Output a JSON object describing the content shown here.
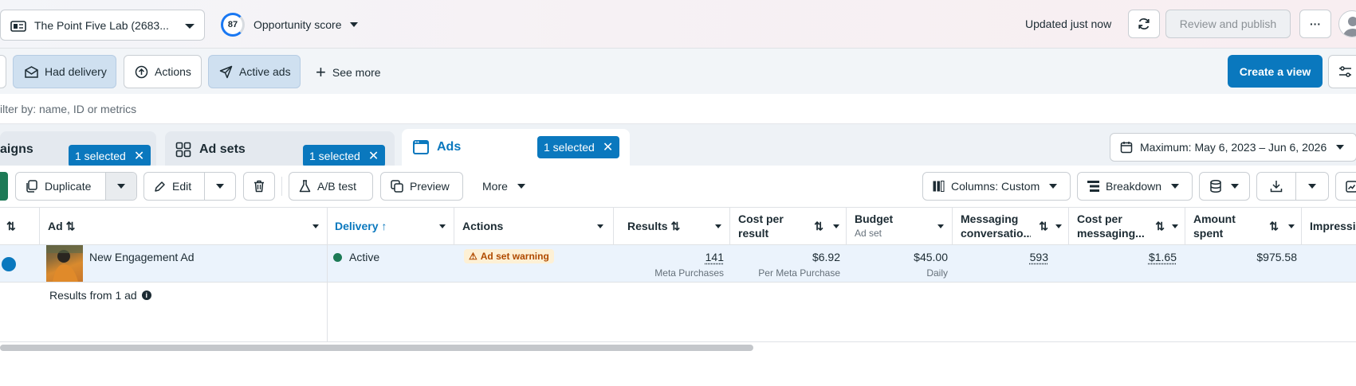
{
  "header": {
    "account_name": "The Point Five Lab (2683...",
    "opportunity_score": "87",
    "opportunity_label": "Opportunity score",
    "updated_text": "Updated just now",
    "review_publish": "Review and publish",
    "more_glyph": "···"
  },
  "filters": {
    "chips": [
      "Had delivery",
      "Actions",
      "Active ads"
    ],
    "see_more": "See more",
    "create_view": "Create a view"
  },
  "search": {
    "placeholder": "ilter by: name, ID or metrics"
  },
  "tabs": {
    "campaigns": "aigns",
    "adsets": "Ad sets",
    "ads": "Ads",
    "selected_label": "1 selected",
    "date_range": "Maximum: May 6, 2023 – Jun 6, 2026"
  },
  "toolbar": {
    "duplicate": "Duplicate",
    "edit": "Edit",
    "ab_test": "A/B test",
    "preview": "Preview",
    "more": "More",
    "columns": "Columns: Custom",
    "breakdown": "Breakdown"
  },
  "table": {
    "headers": {
      "ad": "Ad",
      "delivery": "Delivery",
      "actions": "Actions",
      "results": "Results",
      "cost_per_result": "Cost per result",
      "budget": "Budget",
      "budget_sub": "Ad set",
      "messaging": "Messaging conversatio...",
      "cost_messaging": "Cost per messaging...",
      "amount_spent": "Amount spent",
      "impressions": "Impressio"
    },
    "row": {
      "name": "New Engagement Ad",
      "delivery": "Active",
      "warning": "Ad set warning",
      "results": "141",
      "results_sub": "Meta Purchases",
      "cost_per_result": "$6.92",
      "cost_per_result_sub": "Per Meta Purchase",
      "budget": "$45.00",
      "budget_sub": "Daily",
      "messaging": "593",
      "cost_messaging": "$1.65",
      "amount_spent": "$975.58"
    },
    "summary": "Results from 1 ad"
  },
  "colors": {
    "brand_blue": "#0a78be",
    "active_green": "#1d7a56"
  }
}
